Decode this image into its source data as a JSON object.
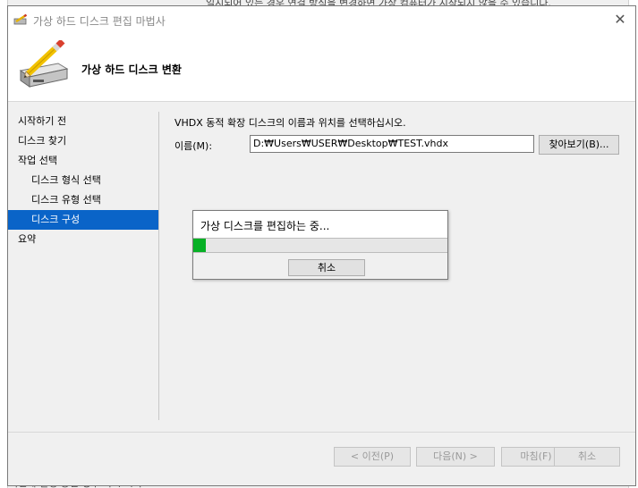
{
  "background": {
    "top_text": "일시되어 있는 경우 연결 방식을 변경하면 가상 컴퓨터가 시작되지 않을 수 있습니다.",
    "bottom_text": "이전에 실행 중인 경우 다시 시작"
  },
  "window": {
    "title": "가상 하드 디스크 편집 마법사",
    "header_title": "가상 하드 디스크 변환"
  },
  "nav": {
    "items": [
      {
        "label": "시작하기 전"
      },
      {
        "label": "디스크 찾기"
      },
      {
        "label": "작업 선택"
      },
      {
        "label": "디스크 형식 선택"
      },
      {
        "label": "디스크 유형 선택"
      },
      {
        "label": "디스크 구성"
      },
      {
        "label": "요약"
      }
    ],
    "active_index": 5
  },
  "main": {
    "instruction": "VHDX 동적 확장 디스크의 이름과 위치를 선택하십시오.",
    "name_label": "이름(M):",
    "name_value": "D:₩Users₩USER₩Desktop₩TEST.vhdx",
    "browse_label": "찾아보기(B)..."
  },
  "progress": {
    "message": "가상 디스크를 편집하는 중...",
    "percent": 5,
    "cancel_label": "취소"
  },
  "footer": {
    "prev_label": "< 이전(P)",
    "next_label": "다음(N) >",
    "finish_label": "마침(F)",
    "cancel_label": "취소"
  },
  "colors": {
    "accent": "#0a64c8",
    "progress": "#06b025"
  }
}
